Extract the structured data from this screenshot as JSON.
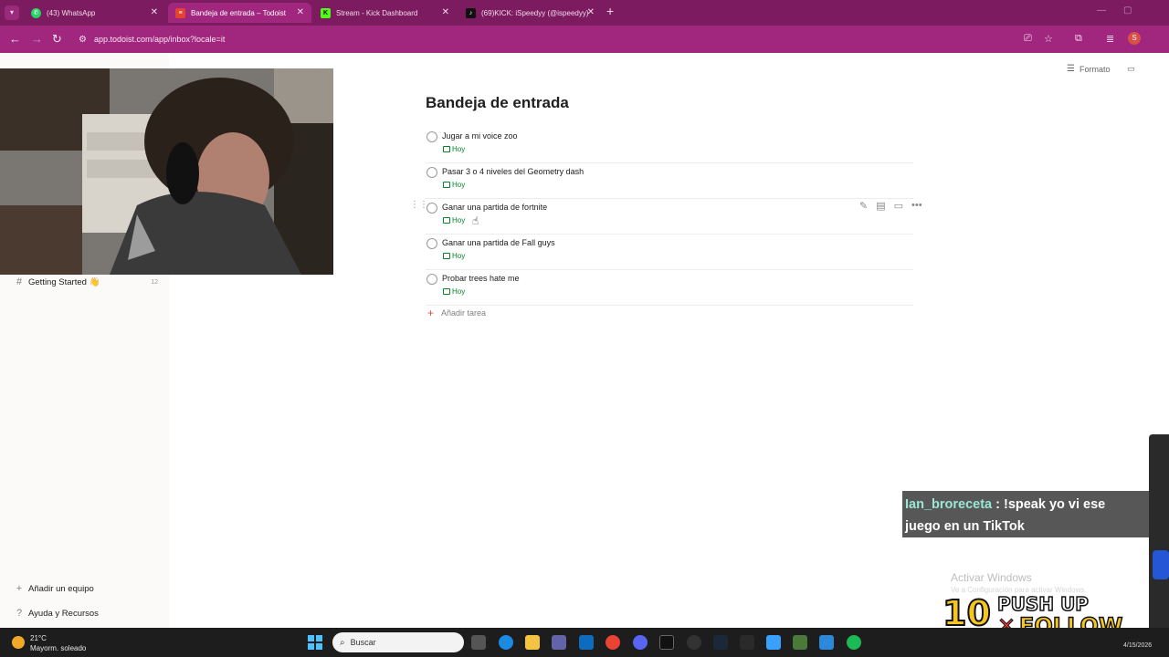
{
  "browser": {
    "tabs": [
      {
        "title": "(43) WhatsApp",
        "icon": "whatsapp-icon",
        "color": "#25d366"
      },
      {
        "title": "Bandeja de entrada – Todoist",
        "icon": "todoist-icon",
        "color": "#e44332"
      },
      {
        "title": "Stream - Kick Dashboard",
        "icon": "kick-icon",
        "color": "#53fc18"
      },
      {
        "title": "(69)KICK: iSpeedyy (@ispeedyy)",
        "icon": "tiktok-icon",
        "color": "#111111"
      }
    ],
    "url": "app.todoist.com/app/inbox?locale=it",
    "profile_initial": "S",
    "accent": "#a0267e"
  },
  "sidebar": {
    "getting_started": "Getting Started 👋",
    "getting_started_count": "12",
    "add_team": "Añadir un equipo",
    "help": "Ayuda y Recursos"
  },
  "header": {
    "format": "Formato"
  },
  "main": {
    "title": "Bandeja de entrada",
    "tasks": [
      {
        "content": "Jugar a mi voice zoo",
        "due": "Hoy"
      },
      {
        "content": "Pasar 3 o 4 niveles del Geometry dash",
        "due": "Hoy"
      },
      {
        "content": "Ganar una partida de fortnite",
        "due": "Hoy"
      },
      {
        "content": "Ganar una partida de Fall guys",
        "due": "Hoy"
      },
      {
        "content": "Probar trees hate me",
        "due": "Hoy"
      }
    ],
    "add_task": "Añadir tarea"
  },
  "overlay": {
    "chat_user": "Ian_broreceta",
    "chat_message": " : !speak yo vi ese juego en un TikTok",
    "activate_windows": "Activar Windows",
    "activate_sub": "Ve a Configuración para activar Windows.",
    "promo_number": "10",
    "promo_line1": "PUSH UP",
    "promo_line2": "FOLLOW"
  },
  "taskbar": {
    "temp": "21°C",
    "condition": "Mayorm. soleado",
    "search_placeholder": "Buscar",
    "date": "4/15/2026"
  }
}
